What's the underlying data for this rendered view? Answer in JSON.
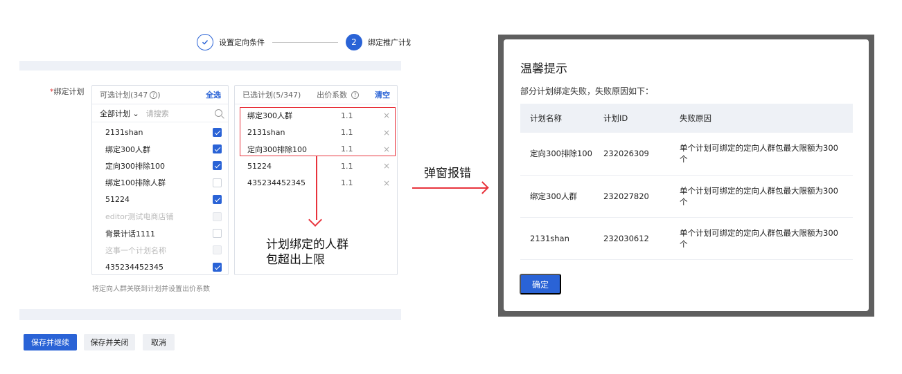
{
  "stepper": {
    "step1_label": "设置定向条件",
    "step2_number": "2",
    "step2_label": "绑定推广计划"
  },
  "form": {
    "required_mark": "*",
    "field_label": "绑定计划",
    "hint": "将定向人群关联到计划并设置出价系数"
  },
  "available": {
    "title": "可选计划(347",
    "help_glyph": "?",
    "title_close": ")",
    "select_all": "全选",
    "filter_label": "全部计划",
    "filter_arrow": "⌄",
    "search_placeholder": "请搜索",
    "items": [
      {
        "name": "2131shan",
        "state": "checked"
      },
      {
        "name": "绑定300人群",
        "state": "checked"
      },
      {
        "name": "定向300排除100",
        "state": "checked"
      },
      {
        "name": "绑定100排除人群",
        "state": "unchecked"
      },
      {
        "name": "51224",
        "state": "checked"
      },
      {
        "name": "editor测试电商店铺",
        "state": "disabled"
      },
      {
        "name": "背景计话1111",
        "state": "unchecked"
      },
      {
        "name": "这事一个计划名称",
        "state": "disabled"
      },
      {
        "name": "435234452345",
        "state": "checked"
      }
    ]
  },
  "selected": {
    "title": "已选计划(5/347)",
    "coef_header": "出价系数",
    "help_glyph": "?",
    "clear": "清空",
    "items": [
      {
        "name": "绑定300人群",
        "coef": "1.1",
        "remove": "×"
      },
      {
        "name": "2131shan",
        "coef": "1.1",
        "remove": "×"
      },
      {
        "name": "定向300排除100",
        "coef": "1.1",
        "remove": "×"
      },
      {
        "name": "51224",
        "coef": "1.1",
        "remove": "×"
      },
      {
        "name": "435234452345",
        "coef": "1.1",
        "remove": "×"
      }
    ]
  },
  "annotation": {
    "line1": "计划绑定的人群",
    "line2": "包超出上限",
    "error_label": "弹窗报错"
  },
  "buttons": {
    "save_continue": "保存并继续",
    "save_close": "保存并关闭",
    "cancel": "取消"
  },
  "dialog": {
    "title": "温馨提示",
    "subtitle": "部分计划绑定失败，失败原因如下：",
    "columns": [
      "计划名称",
      "计划ID",
      "失败原因"
    ],
    "rows": [
      {
        "name": "定向300排除100",
        "id": "232026309",
        "reason": "单个计划可绑定的定向人群包最大限额为300个"
      },
      {
        "name": "绑定300人群",
        "id": "232027820",
        "reason": "单个计划可绑定的定向人群包最大限额为300个"
      },
      {
        "name": "2131shan",
        "id": "232030612",
        "reason": "单个计划可绑定的定向人群包最大限额为300个"
      }
    ],
    "ok": "确定"
  },
  "colors": {
    "primary": "#2a63d6",
    "annotation_red": "#e8333c"
  }
}
